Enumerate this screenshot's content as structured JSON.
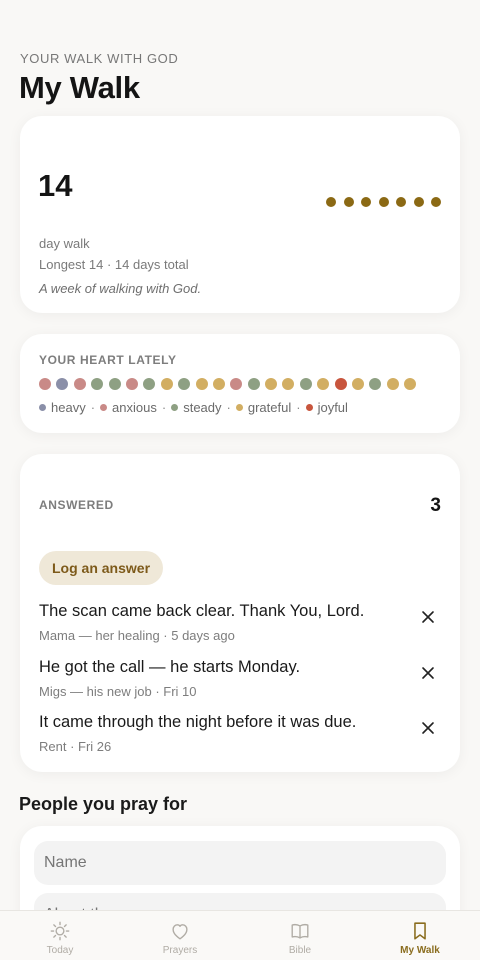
{
  "header": {
    "eyebrow": "YOUR WALK WITH GOD",
    "title": "My Walk"
  },
  "streak": {
    "count": "14",
    "label": "day walk",
    "longest": "Longest 14 · 14 days total",
    "note": "A week of walking with God.",
    "dots_filled": 7,
    "dot_color": "#8b6914"
  },
  "heart": {
    "label": "YOUR HEART LATELY",
    "moods": [
      "anxious",
      "heavy",
      "anxious",
      "steady",
      "steady",
      "anxious",
      "steady",
      "grateful",
      "steady",
      "grateful",
      "grateful",
      "anxious",
      "steady",
      "grateful",
      "grateful",
      "steady",
      "grateful",
      "joyful",
      "grateful",
      "steady",
      "grateful",
      "grateful"
    ],
    "legend": [
      {
        "name": "heavy",
        "color": "#8a8fa8"
      },
      {
        "name": "anxious",
        "color": "#c98a87"
      },
      {
        "name": "steady",
        "color": "#8ea083"
      },
      {
        "name": "grateful",
        "color": "#d2ae62"
      },
      {
        "name": "joyful",
        "color": "#c8553d"
      }
    ]
  },
  "answered": {
    "label": "ANSWERED",
    "count": "3",
    "log_button": "Log an answer",
    "items": [
      {
        "text": "The scan came back clear. Thank You, Lord.",
        "meta": "Mama — her healing · 5 days ago"
      },
      {
        "text": "He got the call — he starts Monday.",
        "meta": "Migs — his new job · Fri 10"
      },
      {
        "text": "It came through the night before it was due.",
        "meta": "Rent · Fri 26"
      }
    ]
  },
  "people": {
    "heading": "People you pray for",
    "name_placeholder": "Name",
    "about_placeholder": "About them"
  },
  "tabs": [
    {
      "label": "Today",
      "icon": "sun-icon",
      "active": false
    },
    {
      "label": "Prayers",
      "icon": "heart-icon",
      "active": false
    },
    {
      "label": "Bible",
      "icon": "book-icon",
      "active": false
    },
    {
      "label": "My Walk",
      "icon": "bookmark-icon",
      "active": true
    }
  ],
  "colors": {
    "accent": "#8a6d1f",
    "background": "#f9f8f6"
  }
}
